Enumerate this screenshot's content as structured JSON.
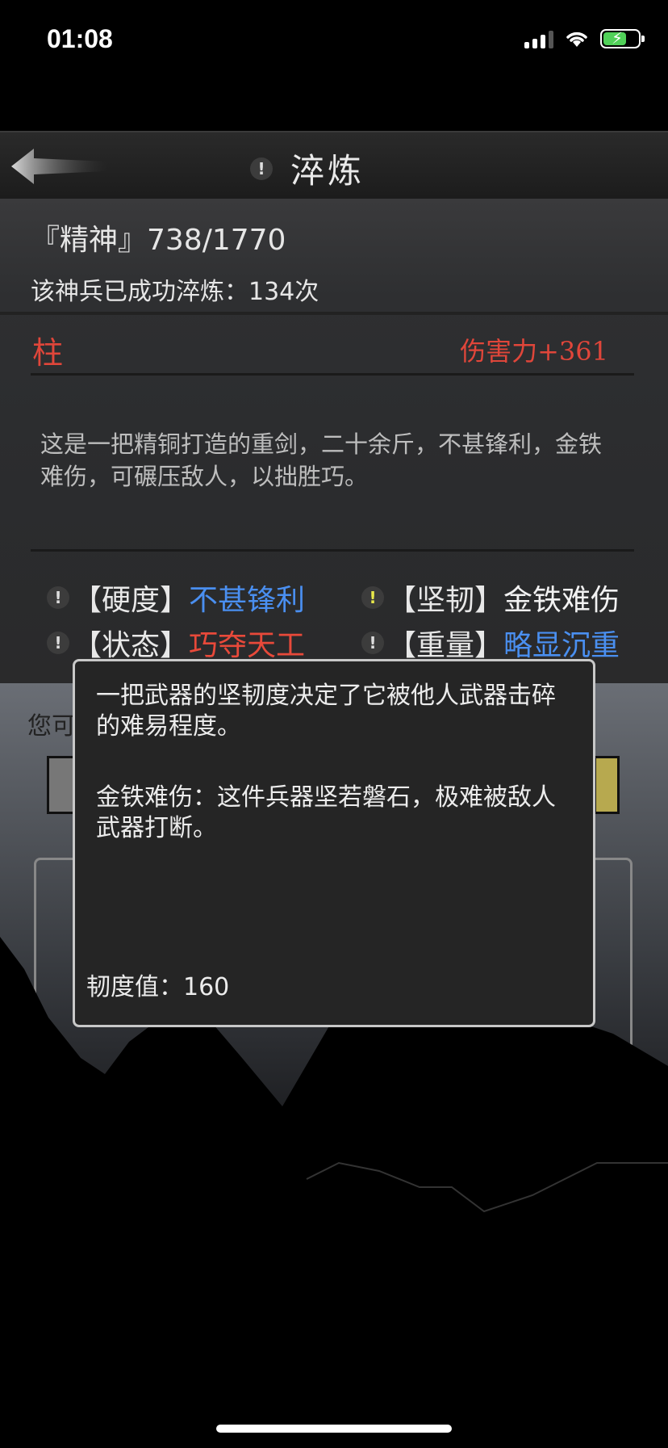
{
  "status": {
    "time": "01:08"
  },
  "header": {
    "title": "淬炼",
    "info_glyph": "!"
  },
  "summary": {
    "spirit": "『精神』738/1770",
    "refined": "该神兵已成功淬炼：134次"
  },
  "weapon": {
    "name": "柱",
    "damage": "伤害力+361",
    "description": "这是一把精铜打造的重剑，二十余斤，不甚锋利，金铁难伤，可碾压敌人，以拙胜巧。"
  },
  "attributes": [
    {
      "label": "【硬度】",
      "value": "不甚锋利",
      "color": "#4a8ff0"
    },
    {
      "label": "【坚韧】",
      "value": "金铁难伤",
      "color": "#f2f2f2"
    },
    {
      "label": "【状态】",
      "value": "巧夺天工",
      "color": "#e8493a"
    },
    {
      "label": "【重量】",
      "value": "略显沉重",
      "color": "#4a8ff0"
    }
  ],
  "behind": {
    "prompt": "您可"
  },
  "tooltip": {
    "p1": "一把武器的坚韧度决定了它被他人武器击碎的难易程度。",
    "p2": "金铁难伤：这件兵器坚若磐石，极难被敌人武器打断。",
    "value": "韧度值：160"
  },
  "colors": {
    "accent_red": "#e0463a",
    "accent_blue": "#4a8ff0",
    "battery_green": "#51d159"
  }
}
